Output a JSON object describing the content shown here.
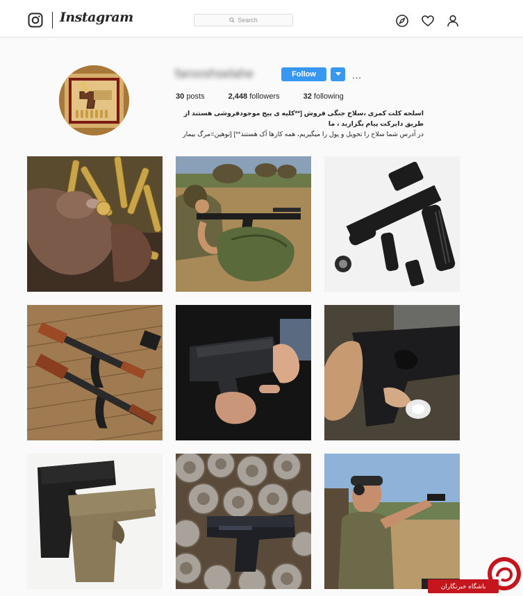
{
  "nav": {
    "brand": "Instagram",
    "search_placeholder": "Search",
    "icons": [
      "instagram-glyph-icon",
      "compass-icon",
      "heart-icon",
      "person-icon"
    ]
  },
  "profile": {
    "username": "farooshselahe",
    "follow_label": "Follow",
    "more_label": "...",
    "posts_count": "30",
    "posts_label": "posts",
    "followers_count": "2,448",
    "followers_label": "followers",
    "following_count": "32",
    "following_label": "following",
    "bio_line1": "اسلحه کلت کمری ،سلاح جنگی فروش [**کلیه ی پیج موجودفروشی هستند از طریق دایرکت پیام بگزارید ، ما",
    "bio_line2": "در آدرس شما سلاح را تحویل و پول را میگیریم، همه کارها آک هستند**] [توهین=مرگ بیمار"
  },
  "posts": [
    {
      "subject": "hand holding rifle cartridges"
    },
    {
      "subject": "soldiers aiming rifles on the ground"
    },
    {
      "subject": "tactical rifle with flashlight and red-dot sight"
    },
    {
      "subject": "two AK-47 rifles on wooden floor"
    },
    {
      "subject": "hand holding black pistol"
    },
    {
      "subject": "hand holding pistol close-up"
    },
    {
      "subject": "two Glock pistols black and tan"
    },
    {
      "subject": "pistol among pine cones"
    },
    {
      "subject": "man shooting pistol at range"
    }
  ],
  "watermark": {
    "text": "باشگاه خبرنگاران"
  },
  "colors": {
    "accent": "#3897f0",
    "background": "#fafafa",
    "border": "#dbdbdb",
    "watermark_red": "#c4161c"
  }
}
